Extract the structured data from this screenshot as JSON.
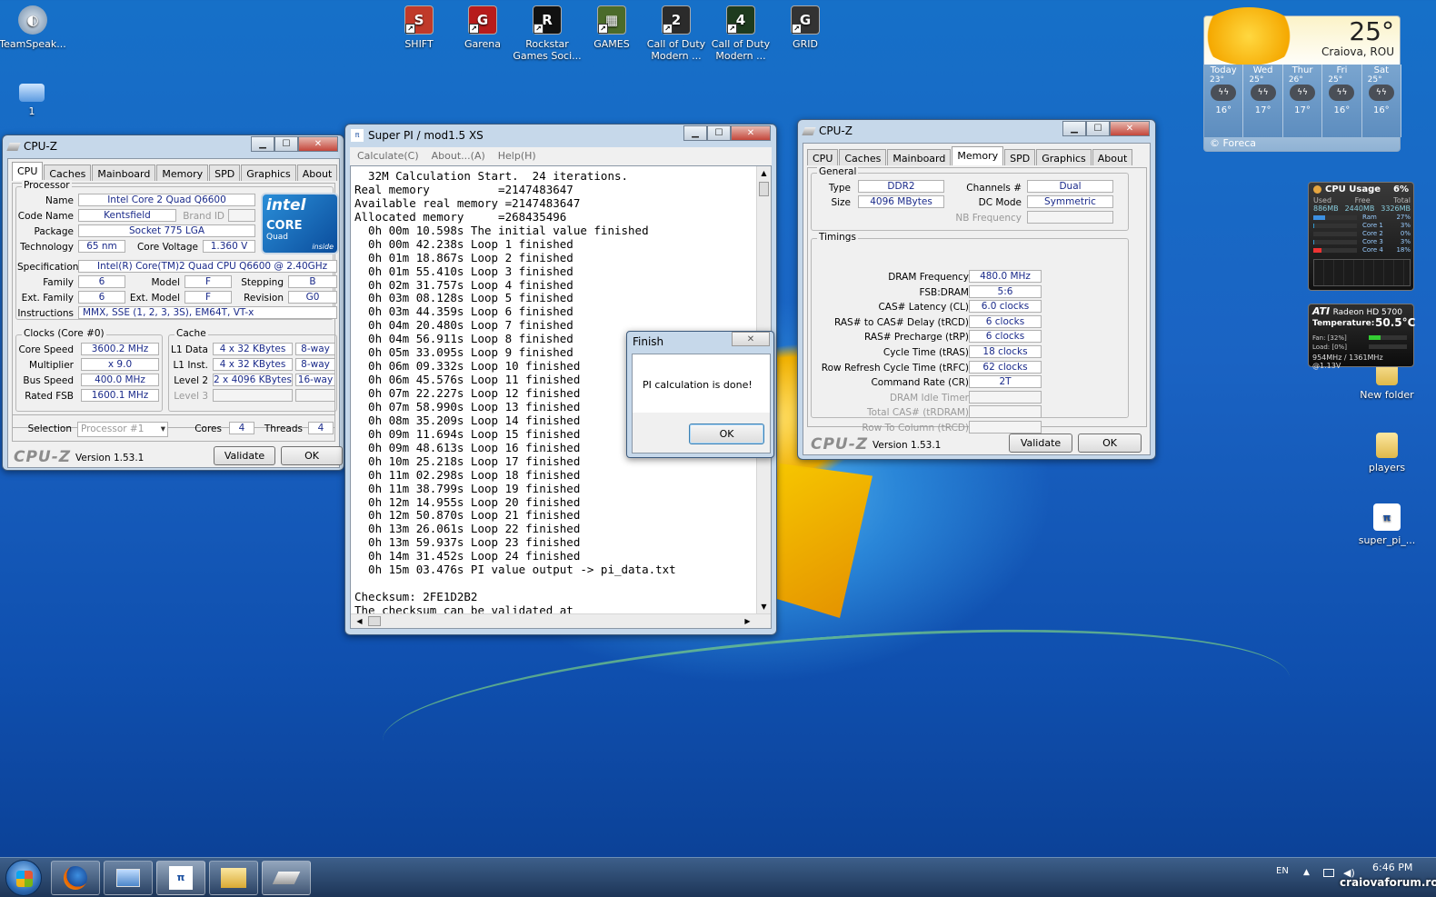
{
  "desktop": {
    "icons_left": [
      {
        "label": "TeamSpeak...",
        "name": "teamspeak"
      },
      {
        "label": "1",
        "name": "computer"
      }
    ],
    "icons_top": [
      {
        "label": "SHIFT",
        "sub": "",
        "color": "#c03a2a",
        "glyph": "S"
      },
      {
        "label": "Garena",
        "sub": "",
        "color": "#b71c1c",
        "glyph": "G"
      },
      {
        "label": "Rockstar",
        "sub": "Games Soci...",
        "color": "#111111",
        "glyph": "R"
      },
      {
        "label": "GAMES",
        "sub": "",
        "color": "#4b6b2a",
        "glyph": "▦"
      },
      {
        "label": "Call of Duty",
        "sub": "Modern ...",
        "color": "#2b2b2b",
        "glyph": "2"
      },
      {
        "label": "Call of Duty",
        "sub": "Modern ...",
        "color": "#1e3b1e",
        "glyph": "4"
      },
      {
        "label": "GRID",
        "sub": "",
        "color": "#333333",
        "glyph": "G"
      }
    ],
    "icons_right": [
      {
        "label": "New folder"
      },
      {
        "label": "players"
      },
      {
        "label": "super_pi_..."
      }
    ]
  },
  "weather": {
    "temp": "25°",
    "city": "Craiova, ROU",
    "days": [
      "Today",
      "Wed",
      "Thur",
      "Fri",
      "Sat"
    ],
    "highs": [
      "23°",
      "25°",
      "26°",
      "25°",
      "25°"
    ],
    "lows": [
      "16°",
      "17°",
      "17°",
      "16°",
      "16°"
    ],
    "source": "© Foreca"
  },
  "cpu_gadget": {
    "title": "CPU Usage",
    "pct": "6%",
    "h_used": "Used",
    "h_free": "Free",
    "h_total": "Total",
    "used": "886MB",
    "free": "2440MB",
    "total": "3326MB",
    "rows": [
      {
        "label": "Ram",
        "val": "27%",
        "fill": 0.27
      },
      {
        "label": "Core 1",
        "val": "3%",
        "fill": 0.03
      },
      {
        "label": "Core 2",
        "val": "0%",
        "fill": 0
      },
      {
        "label": "Core 3",
        "val": "3%",
        "fill": 0.03
      },
      {
        "label": "Core 4",
        "val": "18%",
        "fill": 0.18
      }
    ]
  },
  "ati_gadget": {
    "brand": "ATI",
    "model": "Radeon HD 5700",
    "temp_label": "Temperature:",
    "temp": "50.5°C",
    "fan": "Fan: [32%]",
    "load": "Load: [0%]",
    "clocks": "954MHz / 1361MHz @1.13V"
  },
  "cpuz1": {
    "title": "CPU-Z",
    "tabs": [
      "CPU",
      "Caches",
      "Mainboard",
      "Memory",
      "SPD",
      "Graphics",
      "About"
    ],
    "processor_title": "Processor",
    "labels": {
      "name": "Name",
      "codename": "Code Name",
      "brandid": "Brand ID",
      "package": "Package",
      "technology": "Technology",
      "voltage": "Core Voltage",
      "spec": "Specification",
      "family": "Family",
      "model": "Model",
      "stepping": "Stepping",
      "extfamily": "Ext. Family",
      "extmodel": "Ext. Model",
      "revision": "Revision",
      "instructions": "Instructions"
    },
    "values": {
      "name": "Intel Core 2 Quad Q6600",
      "codename": "Kentsfield",
      "package": "Socket 775 LGA",
      "technology": "65 nm",
      "voltage": "1.360 V",
      "spec": "Intel(R) Core(TM)2 Quad CPU    Q6600  @ 2.40GHz",
      "family": "6",
      "model": "F",
      "stepping": "B",
      "extfamily": "6",
      "extmodel": "F",
      "revision": "G0",
      "instructions": "MMX, SSE (1, 2, 3, 3S), EM64T, VT-x"
    },
    "intel_logo": {
      "intel": "intel",
      "core": "CORE",
      "quad": "Quad",
      "inside": "inside"
    },
    "clocks_title": "Clocks (Core #0)",
    "clocks": [
      {
        "label": "Core Speed",
        "value": "3600.2 MHz"
      },
      {
        "label": "Multiplier",
        "value": "x 9.0"
      },
      {
        "label": "Bus Speed",
        "value": "400.0 MHz"
      },
      {
        "label": "Rated FSB",
        "value": "1600.1 MHz"
      }
    ],
    "cache_title": "Cache",
    "cache": [
      {
        "label": "L1 Data",
        "value": "4 x 32 KBytes",
        "way": "8-way"
      },
      {
        "label": "L1 Inst.",
        "value": "4 x 32 KBytes",
        "way": "8-way"
      },
      {
        "label": "Level 2",
        "value": "2 x 4096 KBytes",
        "way": "16-way"
      },
      {
        "label": "Level 3",
        "value": "",
        "way": ""
      }
    ],
    "selection_label": "Selection",
    "selection": "Processor #1",
    "cores_label": "Cores",
    "cores": "4",
    "threads_label": "Threads",
    "threads": "4",
    "logo": "CPU-Z",
    "version": "Version 1.53.1",
    "validate": "Validate",
    "ok": "OK"
  },
  "superpi": {
    "title": "Super PI / mod1.5 XS",
    "menu": [
      "Calculate(C)",
      "About...(A)",
      "Help(H)"
    ],
    "lines": [
      "  32M Calculation Start.  24 iterations.",
      "Real memory          =2147483647",
      "Available real memory =2147483647",
      "Allocated memory     =268435496",
      "  0h 00m 10.598s The initial value finished",
      "  0h 00m 42.238s Loop 1 finished",
      "  0h 01m 18.867s Loop 2 finished",
      "  0h 01m 55.410s Loop 3 finished",
      "  0h 02m 31.757s Loop 4 finished",
      "  0h 03m 08.128s Loop 5 finished",
      "  0h 03m 44.359s Loop 6 finished",
      "  0h 04m 20.480s Loop 7 finished",
      "  0h 04m 56.911s Loop 8 finished",
      "  0h 05m 33.095s Loop 9 finished",
      "  0h 06m 09.332s Loop 10 finished",
      "  0h 06m 45.576s Loop 11 finished",
      "  0h 07m 22.227s Loop 12 finished",
      "  0h 07m 58.990s Loop 13 finished",
      "  0h 08m 35.209s Loop 14 finished",
      "  0h 09m 11.694s Loop 15 finished",
      "  0h 09m 48.613s Loop 16 finished",
      "  0h 10m 25.218s Loop 17 finished",
      "  0h 11m 02.298s Loop 18 finished",
      "  0h 11m 38.799s Loop 19 finished",
      "  0h 12m 14.955s Loop 20 finished",
      "  0h 12m 50.870s Loop 21 finished",
      "  0h 13m 26.061s Loop 22 finished",
      "  0h 13m 59.937s Loop 23 finished",
      "  0h 14m 31.452s Loop 24 finished",
      "  0h 15m 03.476s PI value output -> pi_data.txt",
      "",
      "Checksum: 2FE1D2B2",
      "The checksum can be validated at"
    ]
  },
  "finish": {
    "title": "Finish",
    "message": "PI calculation is done!",
    "ok": "OK"
  },
  "cpuz2": {
    "title": "CPU-Z",
    "tabs": [
      "CPU",
      "Caches",
      "Mainboard",
      "Memory",
      "SPD",
      "Graphics",
      "About"
    ],
    "general_title": "General",
    "general": {
      "type_label": "Type",
      "type": "DDR2",
      "size_label": "Size",
      "size": "4096 MBytes",
      "channels_label": "Channels #",
      "channels": "Dual",
      "dcmode_label": "DC Mode",
      "dcmode": "Symmetric",
      "nbfreq_label": "NB Frequency",
      "nbfreq": ""
    },
    "timings_title": "Timings",
    "timings": [
      {
        "label": "DRAM Frequency",
        "value": "480.0 MHz",
        "dim": false
      },
      {
        "label": "FSB:DRAM",
        "value": "5:6",
        "dim": false
      },
      {
        "label": "CAS# Latency (CL)",
        "value": "6.0 clocks",
        "dim": false
      },
      {
        "label": "RAS# to CAS# Delay (tRCD)",
        "value": "6 clocks",
        "dim": false
      },
      {
        "label": "RAS# Precharge (tRP)",
        "value": "6 clocks",
        "dim": false
      },
      {
        "label": "Cycle Time (tRAS)",
        "value": "18 clocks",
        "dim": false
      },
      {
        "label": "Row Refresh Cycle Time (tRFC)",
        "value": "62 clocks",
        "dim": false
      },
      {
        "label": "Command Rate (CR)",
        "value": "2T",
        "dim": false
      },
      {
        "label": "DRAM Idle Timer",
        "value": "",
        "dim": true
      },
      {
        "label": "Total CAS# (tRDRAM)",
        "value": "",
        "dim": true
      },
      {
        "label": "Row To Column (tRCD)",
        "value": "",
        "dim": true
      }
    ],
    "logo": "CPU-Z",
    "version": "Version 1.53.1",
    "validate": "Validate",
    "ok": "OK"
  },
  "taskbar": {
    "lang": "EN",
    "time": "6:46 PM",
    "watermark": "craiovaforum.ro",
    "buttons": [
      "start",
      "firefox",
      "computer",
      "superpi",
      "explorer",
      "cpuz"
    ]
  }
}
